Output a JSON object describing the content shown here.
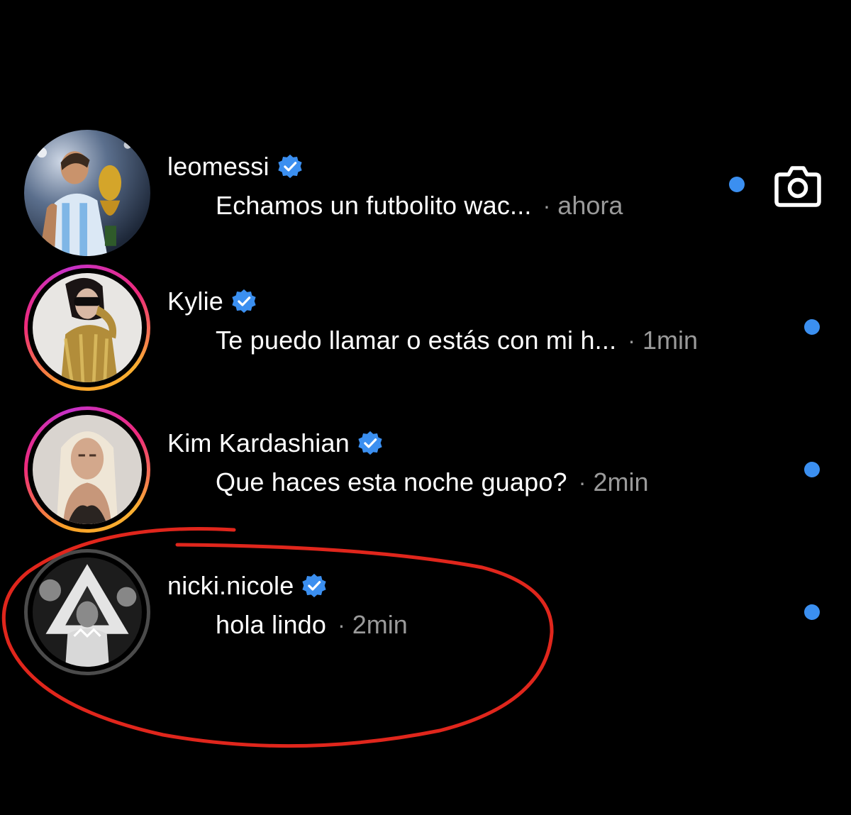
{
  "colors": {
    "background": "#000000",
    "text_primary": "#ffffff",
    "text_secondary": "#9a9a9a",
    "unread_dot": "#3b8ff0",
    "verified_badge": "#3b8ff0",
    "annotation": "#e0261c"
  },
  "camera": {
    "icon": "camera-icon"
  },
  "threads": [
    {
      "name": "leomessi",
      "verified": true,
      "preview": "Echamos un futbolito wac...",
      "separator": "·",
      "time": "ahora",
      "story_ring": "none",
      "unread": true
    },
    {
      "name": "Kylie",
      "verified": true,
      "preview": "Te puedo llamar o estás con mi h...",
      "separator": "·",
      "time": "1min",
      "story_ring": "gradient",
      "unread": true
    },
    {
      "name": "Kim Kardashian",
      "verified": true,
      "preview": "Que haces esta noche guapo?",
      "separator": "·",
      "time": "2min",
      "story_ring": "gradient",
      "unread": true
    },
    {
      "name": "nicki.nicole",
      "verified": true,
      "preview": "hola lindo",
      "separator": "·",
      "time": "2min",
      "story_ring": "seen",
      "unread": true,
      "annotated": true
    }
  ]
}
